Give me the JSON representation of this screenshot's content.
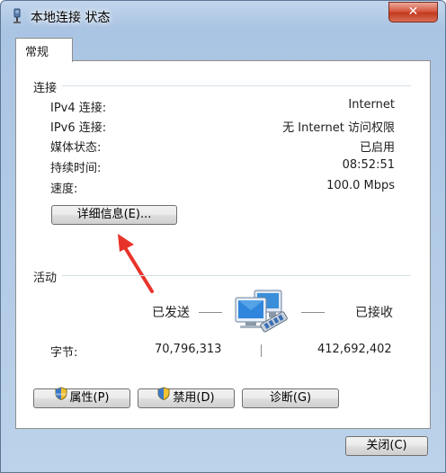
{
  "window": {
    "title": "本地连接 状态",
    "close_glyph": "✕"
  },
  "tabs": [
    {
      "label": "常规"
    }
  ],
  "connection": {
    "section_label": "连接",
    "rows": [
      {
        "label": "IPv4 连接:",
        "value": "Internet"
      },
      {
        "label": "IPv6 连接:",
        "value": "无 Internet 访问权限"
      },
      {
        "label": "媒体状态:",
        "value": "已启用"
      },
      {
        "label": "持续时间:",
        "value": "08:52:51"
      },
      {
        "label": "速度:",
        "value": "100.0 Mbps"
      }
    ],
    "details_button": "详细信息(E)..."
  },
  "activity": {
    "section_label": "活动",
    "sent_label": "已发送",
    "received_label": "已接收",
    "bytes_label": "字节:",
    "bytes_sent": "70,796,313",
    "bytes_received": "412,692,402"
  },
  "buttons": {
    "properties": "属性(P)",
    "disable": "禁用(D)",
    "diagnose": "诊断(G)",
    "close": "关闭(C)"
  },
  "colors": {
    "annotation_arrow": "#e8332b"
  }
}
